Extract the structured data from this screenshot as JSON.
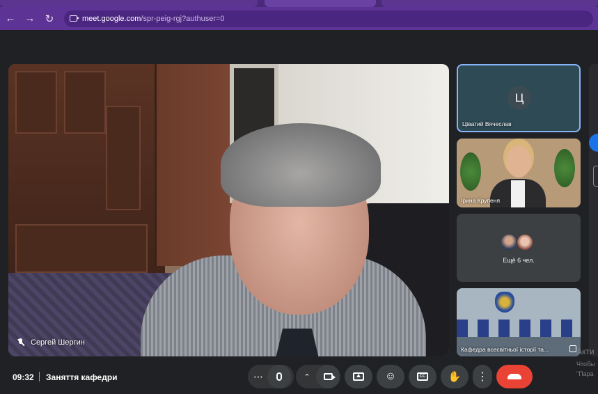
{
  "browser": {
    "url_host": "meet.google.com",
    "url_path": "/spr-peig-rgj?authuser=0"
  },
  "main_speaker": {
    "name": "Сергей Шергин"
  },
  "side_tiles": [
    {
      "name": "Ціватий Вячеслав",
      "avatar_letter": "Ц"
    },
    {
      "name": "Ірина Крупеня"
    },
    {
      "more_label": "Ещё 6 чел."
    },
    {
      "name": "Кафедра всесвітньої історії та..."
    }
  ],
  "bottom_bar": {
    "time": "09:32",
    "meeting_title": "Заняття кафедри"
  },
  "watermark": {
    "title": "Акти",
    "line1": "Чтобы",
    "line2": "\"Пара"
  },
  "colors": {
    "browser_frame": "#5e3396",
    "active_tile_border": "#8ab4f8",
    "hangup": "#ea4335",
    "control_bg": "#3c4043"
  },
  "icons": [
    "back-arrow-icon",
    "forward-arrow-icon",
    "reload-icon",
    "site-info-icon",
    "mic-off-icon",
    "more-options-icon",
    "mic-icon",
    "chevron-up-icon",
    "camera-icon",
    "present-screen-icon",
    "emoji-icon",
    "captions-icon",
    "raise-hand-icon",
    "more-vert-icon",
    "hangup-phone-icon",
    "pin-icon"
  ]
}
